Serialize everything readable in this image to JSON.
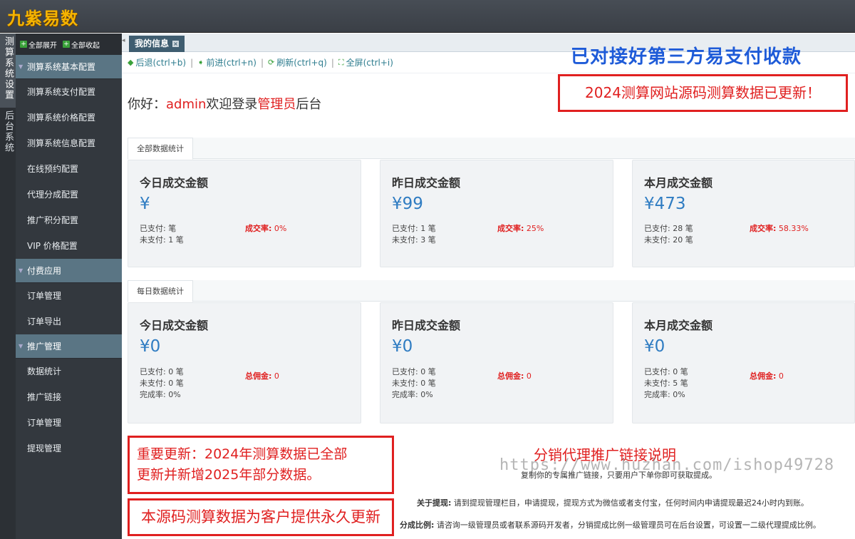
{
  "app": {
    "logo": "九紫易数"
  },
  "vtabs": [
    {
      "label": "测算系统设置"
    },
    {
      "label": "后台系统"
    }
  ],
  "sidebar": {
    "expand_all": "全部展开",
    "collapse_all": "全部收起",
    "groups": [
      {
        "label": "测算系统基本配置",
        "items": [
          "测算系统支付配置",
          "测算系统价格配置",
          "测算系统信息配置",
          "在线预约配置",
          "代理分成配置",
          "推广积分配置",
          "VIP 价格配置"
        ]
      },
      {
        "label": "付费应用",
        "items": [
          "订单管理",
          "订单导出"
        ]
      },
      {
        "label": "推广管理",
        "items": [
          "数据统计",
          "推广链接",
          "订单管理",
          "提现管理"
        ]
      }
    ]
  },
  "tab": {
    "label": "我的信息"
  },
  "toolbar": {
    "back": "后退(ctrl+b)",
    "forward": "前进(ctrl+n)",
    "refresh": "刷新(ctrl+q)",
    "fullscreen": "全屏(ctrl+i)"
  },
  "greeting": {
    "prefix": "你好：",
    "user": "admin",
    "mid": "欢迎登录",
    "role": "管理员",
    "suffix": "后台"
  },
  "promo": {
    "title": "已对接好第三方易支付收款",
    "box1": "2024测算网站源码测算数据已更新！",
    "box2_line1": "重要更新：2024年测算数据已全部",
    "box2_line2": "更新并新增2025年部分数据。",
    "box3": "本源码测算数据为客户提供永久更新"
  },
  "stats_all": {
    "section_label": "全部数据统计",
    "cards": [
      {
        "title": "今日成交金额",
        "amount": "¥",
        "paid": "已支付: 笔",
        "unpaid": "未支付: 1 笔",
        "rate_label": "成交率:",
        "rate": " 0%"
      },
      {
        "title": "昨日成交金额",
        "amount": "¥99",
        "paid": "已支付: 1 笔",
        "unpaid": "未支付: 3 笔",
        "rate_label": "成交率:",
        "rate": " 25%"
      },
      {
        "title": "本月成交金额",
        "amount": "¥473",
        "paid": "已支付: 28 笔",
        "unpaid": "未支付: 20 笔",
        "rate_label": "成交率:",
        "rate": " 58.33%"
      }
    ]
  },
  "stats_daily": {
    "section_label": "每日数据统计",
    "cards": [
      {
        "title": "今日成交金额",
        "amount": "¥0",
        "paid": "已支付: 0 笔",
        "unpaid": "未支付: 0 笔",
        "done": "完成率: 0%",
        "comm_label": "总佣金:",
        "comm": " 0"
      },
      {
        "title": "昨日成交金额",
        "amount": "¥0",
        "paid": "已支付: 0 笔",
        "unpaid": "未支付: 0 笔",
        "done": "完成率: 0%",
        "comm_label": "总佣金:",
        "comm": " 0"
      },
      {
        "title": "本月成交金额",
        "amount": "¥0",
        "paid": "已支付: 0 笔",
        "unpaid": "未支付: 5 笔",
        "done": "完成率: 0%",
        "comm_label": "总佣金:",
        "comm": " 0"
      }
    ]
  },
  "distribution": {
    "title": "分销代理推广链接说明",
    "watermark": "https://www.huzhan.com/ishop49728",
    "subtitle": "复制你的专属推广链接，只要用户下单你即可获取提成。",
    "withdraw_label": "关于提现:",
    "withdraw_text": " 请到提现管理栏目，申请提现，提现方式为微信或者支付宝，任何时间内申请提现最迟24小时内到账。",
    "ratio_label": "分成比例:",
    "ratio_text": " 请咨询一级管理员或者联系源码开发者，分销提成比例一级管理员可在后台设置，可设置一二级代理提成比例。"
  }
}
